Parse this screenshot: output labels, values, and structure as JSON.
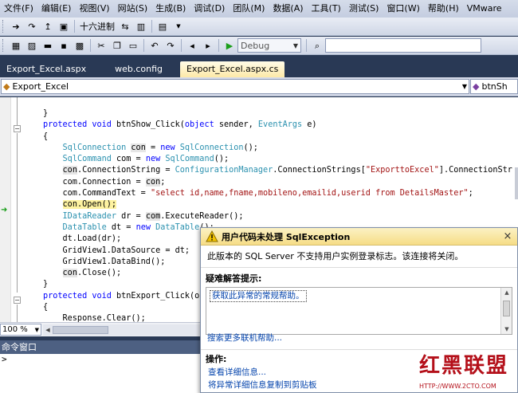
{
  "menubar": {
    "items": [
      "文件(F)",
      "编辑(E)",
      "视图(V)",
      "网站(S)",
      "生成(B)",
      "调试(D)",
      "团队(M)",
      "数据(A)",
      "工具(T)",
      "测试(S)",
      "窗口(W)",
      "帮助(H)",
      "VMware"
    ]
  },
  "toolbar1": {
    "hex_label": "十六进制"
  },
  "toolbar2": {
    "config_value": "Debug",
    "search_value": ""
  },
  "tabs": [
    {
      "label": "Export_Excel.aspx"
    },
    {
      "label": "web.config"
    },
    {
      "label": "Export_Excel.aspx.cs"
    }
  ],
  "navbar": {
    "class_value": "Export_Excel",
    "member_value": "btnSh"
  },
  "editor": {
    "lines": [
      [
        {
          "t": "}",
          "c": ""
        }
      ],
      [
        {
          "t": "protected",
          "c": "kw"
        },
        {
          "t": " ",
          "c": ""
        },
        {
          "t": "void",
          "c": "kw"
        },
        {
          "t": " btnShow_Click(",
          "c": ""
        },
        {
          "t": "object",
          "c": "kw"
        },
        {
          "t": " sender, ",
          "c": ""
        },
        {
          "t": "EventArgs",
          "c": "ty"
        },
        {
          "t": " e)",
          "c": ""
        }
      ],
      [
        {
          "t": "{",
          "c": ""
        }
      ],
      [
        {
          "t": "    ",
          "c": ""
        },
        {
          "t": "SqlConnection",
          "c": "ty"
        },
        {
          "t": " ",
          "c": ""
        },
        {
          "t": "con",
          "c": "hl"
        },
        {
          "t": " = ",
          "c": ""
        },
        {
          "t": "new",
          "c": "kw"
        },
        {
          "t": " ",
          "c": ""
        },
        {
          "t": "SqlConnection",
          "c": "ty"
        },
        {
          "t": "();",
          "c": ""
        }
      ],
      [
        {
          "t": "    ",
          "c": ""
        },
        {
          "t": "SqlCommand",
          "c": "ty"
        },
        {
          "t": " com = ",
          "c": ""
        },
        {
          "t": "new",
          "c": "kw"
        },
        {
          "t": " ",
          "c": ""
        },
        {
          "t": "SqlCommand",
          "c": "ty"
        },
        {
          "t": "();",
          "c": ""
        }
      ],
      [
        {
          "t": "    ",
          "c": ""
        },
        {
          "t": "con",
          "c": "hl"
        },
        {
          "t": ".ConnectionString = ",
          "c": ""
        },
        {
          "t": "ConfigurationManager",
          "c": "ty"
        },
        {
          "t": ".ConnectionStrings[",
          "c": ""
        },
        {
          "t": "\"ExporttoExcel\"",
          "c": "st"
        },
        {
          "t": "].ConnectionStr",
          "c": ""
        }
      ],
      [
        {
          "t": "    com.Connection = ",
          "c": ""
        },
        {
          "t": "con",
          "c": "hl"
        },
        {
          "t": ";",
          "c": ""
        }
      ],
      [
        {
          "t": "    com.CommandText = ",
          "c": ""
        },
        {
          "t": "\"select id,name,fname,mobileno,emailid,userid from DetailsMaster\"",
          "c": "st"
        },
        {
          "t": ";",
          "c": ""
        }
      ],
      [
        {
          "t": "    ",
          "c": ""
        },
        {
          "t": "con.Open();",
          "c": "cur"
        }
      ],
      [
        {
          "t": "    ",
          "c": ""
        },
        {
          "t": "IDataReader",
          "c": "ty"
        },
        {
          "t": " dr = ",
          "c": ""
        },
        {
          "t": "com",
          "c": "hl"
        },
        {
          "t": ".ExecuteReader();",
          "c": ""
        }
      ],
      [
        {
          "t": "    ",
          "c": ""
        },
        {
          "t": "DataTable",
          "c": "ty"
        },
        {
          "t": " dt = ",
          "c": ""
        },
        {
          "t": "new",
          "c": "kw"
        },
        {
          "t": " ",
          "c": ""
        },
        {
          "t": "DataTable",
          "c": "ty"
        },
        {
          "t": "();",
          "c": ""
        }
      ],
      [
        {
          "t": "    dt.Load(dr);",
          "c": ""
        }
      ],
      [
        {
          "t": "    GridView1.DataSource = dt;",
          "c": ""
        }
      ],
      [
        {
          "t": "    GridView1.DataBind();",
          "c": ""
        }
      ],
      [
        {
          "t": "    ",
          "c": ""
        },
        {
          "t": "con",
          "c": "hl"
        },
        {
          "t": ".Close();",
          "c": ""
        }
      ],
      [
        {
          "t": "}",
          "c": ""
        }
      ],
      [
        {
          "t": "protected",
          "c": "kw"
        },
        {
          "t": " ",
          "c": ""
        },
        {
          "t": "void",
          "c": "kw"
        },
        {
          "t": " btnExport_Click(object sender, EventArgs e)",
          "c": ""
        }
      ],
      [
        {
          "t": "{",
          "c": ""
        }
      ],
      [
        {
          "t": "    Response.Clear();",
          "c": ""
        }
      ]
    ]
  },
  "zoombar": {
    "zoom_value": "100 %"
  },
  "command_window": {
    "title": "命令窗口",
    "prompt": ">"
  },
  "exception_popup": {
    "title": "用户代码未处理 SqlException",
    "message": "此版本的 SQL Server 不支持用户实例登录标志。该连接将关闭。",
    "tips_title": "疑难解答提示:",
    "tips": [
      "获取此异常的常规帮助。"
    ],
    "search_link": "搜索更多联机帮助...",
    "actions_title": "操作:",
    "actions": [
      "查看详细信息...",
      "将异常详细信息复制到剪贴板"
    ]
  },
  "watermark": {
    "text": "红黑联盟",
    "url": "HTTP://WWW.2CTO.COM"
  },
  "colors": {
    "ide_chrome": "#293955",
    "keyword": "#0000ff",
    "type": "#2b91af",
    "string": "#a31515",
    "current_line": "#fdf2a0",
    "popup_header": "#f6dd86",
    "link": "#0645ad",
    "watermark": "#b4101a"
  }
}
